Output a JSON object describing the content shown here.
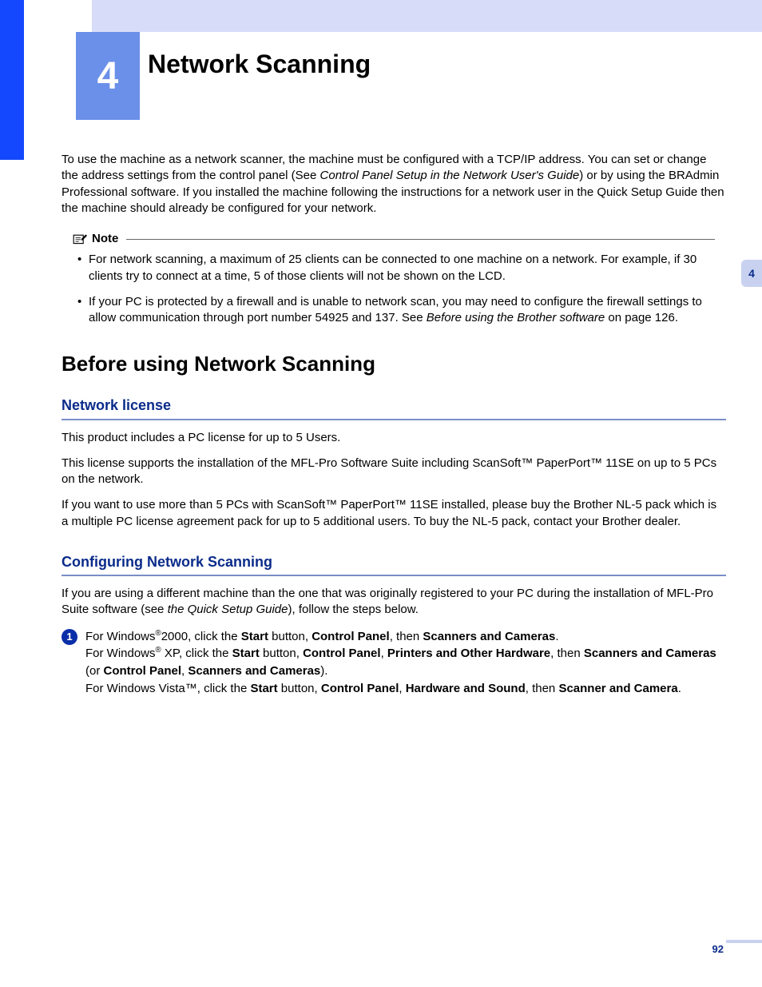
{
  "chapter": {
    "number": "4",
    "title": "Network Scanning"
  },
  "intro_html": "To use the machine as a network scanner, the machine must be configured with a TCP/IP address. You can set or change the address settings from the control panel (See <span class=\"italic\">Control Panel Setup in the Network User's Guide</span>) or by using the BRAdmin Professional software. If you installed the machine following the instructions for a network user in the Quick Setup Guide then the machine should already be configured for your network.",
  "note": {
    "label": "Note",
    "items": [
      "For network scanning, a maximum of 25 clients can be connected to one machine on a network. For example, if 30 clients try to connect at a time, 5 of those clients will not be shown on the LCD.",
      "If your PC is protected by a firewall and is unable to network scan, you may need to configure the firewall settings to allow communication through port number 54925 and 137. See <span class=\"italic\">Before using the Brother software</span> on page 126."
    ]
  },
  "section_h2": "Before using Network Scanning",
  "license": {
    "heading": "Network license",
    "p1": "This product includes a PC license for up to 5 Users.",
    "p2": "This license supports the installation of the MFL-Pro Software Suite including ScanSoft™ PaperPort™ 11SE on up to 5 PCs on the network.",
    "p3": "If you want to use more than 5 PCs with ScanSoft™ PaperPort™ 11SE installed, please buy the Brother NL-5 pack which is a multiple PC license agreement pack for up to 5 additional users. To buy the NL-5 pack, contact your Brother dealer."
  },
  "config": {
    "heading": "Configuring Network Scanning",
    "intro_html": "If you are using a different machine than the one that was originally registered to your PC during the installation of MFL-Pro Suite software (see <span class=\"italic\">the Quick Setup Guide</span>), follow the steps below.",
    "step1_html": "For Windows<span class=\"super\">®</span>2000, click the <span class=\"bold\">Start</span> button, <span class=\"bold\">Control Panel</span>, then <span class=\"bold\">Scanners and Cameras</span>.<br>For Windows<span class=\"super\">®</span> XP, click the <span class=\"bold\">Start</span> button, <span class=\"bold\">Control Panel</span>, <span class=\"bold\">Printers and Other Hardware</span>, then <span class=\"bold\">Scanners and Cameras</span> (or <span class=\"bold\">Control Panel</span>, <span class=\"bold\">Scanners and Cameras</span>).<br>For Windows Vista™, click the <span class=\"bold\">Start</span> button, <span class=\"bold\">Control Panel</span>, <span class=\"bold\">Hardware and Sound</span>, then <span class=\"bold\">Scanner and Camera</span>."
  },
  "side_tab": "4",
  "page_number": "92"
}
